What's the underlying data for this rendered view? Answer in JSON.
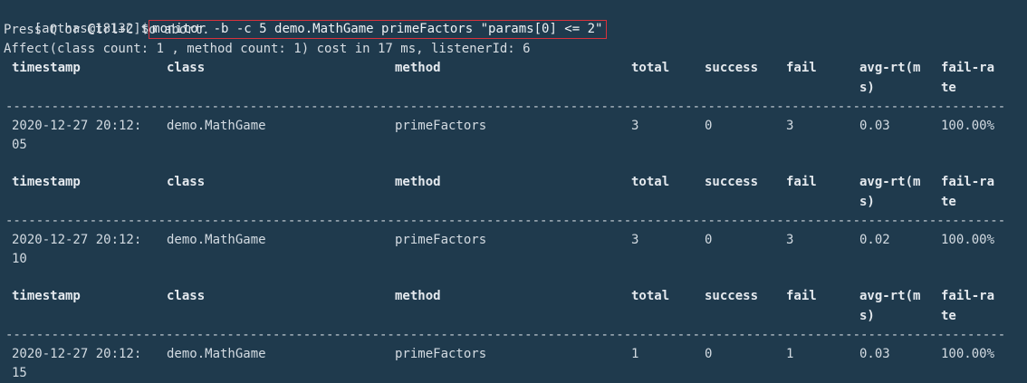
{
  "terminal": {
    "prompt": "[arthas@18132]$",
    "command": "monitor -b -c 5 demo.MathGame primeFactors \"params[0] <= 2\"",
    "abort_hint": "Press Q or Ctrl+C to abort.",
    "affect_line": "Affect(class count: 1 , method count: 1) cost in 17 ms, listenerId: 6",
    "headers": {
      "timestamp": "timestamp",
      "class": "class",
      "method": "method",
      "total": "total",
      "success": "success",
      "fail": "fail",
      "avg_rt_1": "avg-rt(m",
      "avg_rt_2": "s)",
      "fail_rate_1": "fail-ra",
      "fail_rate_2": "te"
    },
    "divider": "--------------------------------------------------------------------------------------------------------------------------------------------------------------",
    "rows": [
      {
        "timestamp_1": "2020-12-27 20:12:",
        "timestamp_2": "05",
        "class": "demo.MathGame",
        "method": "primeFactors",
        "total": "3",
        "success": "0",
        "fail": "3",
        "avg_rt": "0.03",
        "fail_rate": "100.00%"
      },
      {
        "timestamp_1": "2020-12-27 20:12:",
        "timestamp_2": "10",
        "class": "demo.MathGame",
        "method": "primeFactors",
        "total": "3",
        "success": "0",
        "fail": "3",
        "avg_rt": "0.02",
        "fail_rate": "100.00%"
      },
      {
        "timestamp_1": "2020-12-27 20:12:",
        "timestamp_2": "15",
        "class": "demo.MathGame",
        "method": "primeFactors",
        "total": "1",
        "success": "0",
        "fail": "1",
        "avg_rt": "0.03",
        "fail_rate": "100.00%"
      }
    ],
    "colors": {
      "background": "#1f3a4d",
      "text": "#d7dde3",
      "command_border": "#d8323c"
    }
  }
}
